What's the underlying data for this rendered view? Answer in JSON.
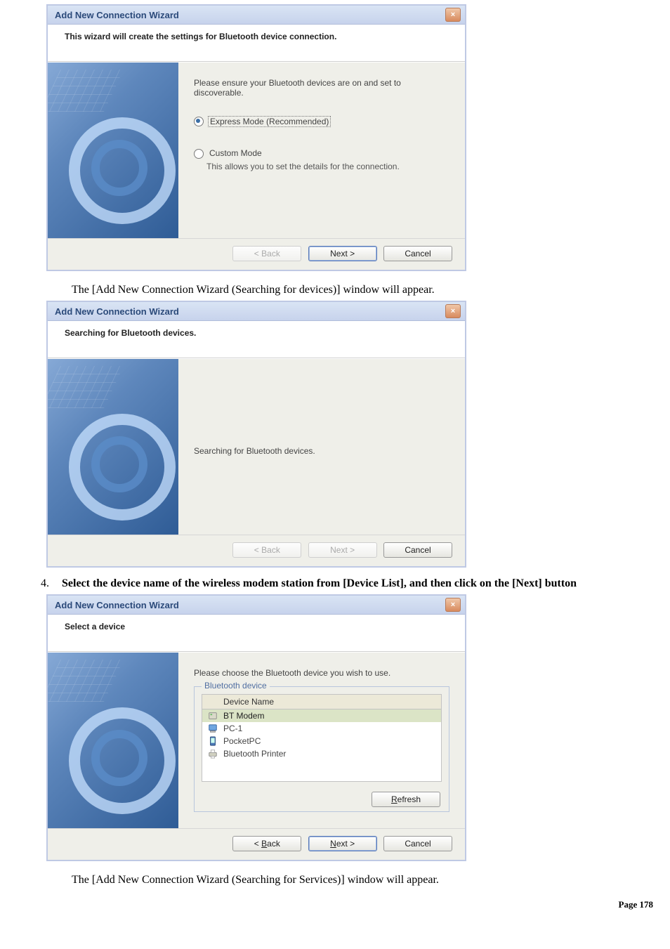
{
  "dlg1": {
    "title": "Add New Connection Wizard",
    "header": "This wizard will create the settings for Bluetooth device connection.",
    "intro": "Please ensure your Bluetooth devices are on and set to discoverable.",
    "opt_express": "Express Mode (Recommended)",
    "opt_custom": "Custom Mode",
    "opt_custom_sub": "This allows you to set the details for the connection.",
    "btn_back": "< Back",
    "btn_next": "Next >",
    "btn_cancel": "Cancel"
  },
  "para1": "The [Add New Connection Wizard (Searching for devices)] window will appear.",
  "dlg2": {
    "title": "Add New Connection Wizard",
    "header": "Searching for Bluetooth devices.",
    "status": "Searching for Bluetooth devices.",
    "btn_back": "< Back",
    "btn_next": "Next >",
    "btn_cancel": "Cancel"
  },
  "step4_num": "4.",
  "step4_text": "Select the device name of the wireless modem station from [Device List], and then click on the [Next] button",
  "dlg3": {
    "title": "Add New Connection Wizard",
    "header": "Select a device",
    "intro": "Please choose the Bluetooth device you wish to use.",
    "fs_legend": "Bluetooth device",
    "col_device": "Device Name",
    "rows": {
      "r0": "BT Modem",
      "r1": "PC-1",
      "r2": "PocketPC",
      "r3": "Bluetooth Printer"
    },
    "btn_refresh": "Refresh",
    "btn_back": "< Back",
    "btn_next": "Next >",
    "btn_cancel": "Cancel"
  },
  "para2": "The [Add New Connection Wizard (Searching for Services)] window will appear.",
  "page_label": "Page 178",
  "underline": {
    "R": "R",
    "B": "B",
    "N": "N"
  }
}
